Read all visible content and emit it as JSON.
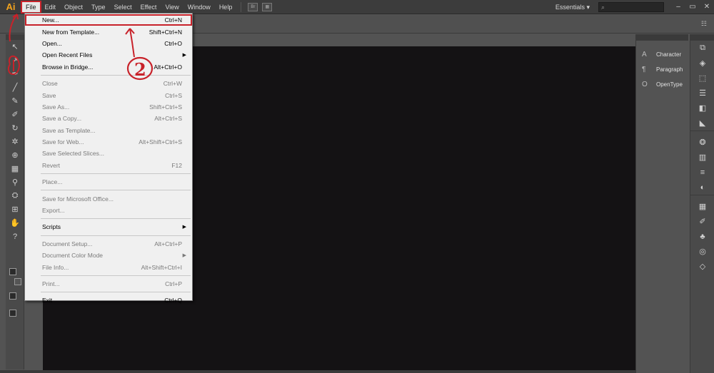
{
  "app": {
    "logo": "Ai"
  },
  "menubar": {
    "items": [
      "File",
      "Edit",
      "Object",
      "Type",
      "Select",
      "Effect",
      "View",
      "Window",
      "Help"
    ],
    "bridge_btn": "Br",
    "workspace": "Essentials",
    "workspace_arrow": "▾",
    "search_icon": "⌕",
    "window_controls": [
      "–",
      "▭",
      "✕"
    ]
  },
  "file_menu": {
    "groups": [
      [
        {
          "label": "New...",
          "shortcut": "Ctrl+N",
          "enabled": true,
          "highlighted": true
        },
        {
          "label": "New from Template...",
          "shortcut": "Shift+Ctrl+N",
          "enabled": true
        },
        {
          "label": "Open...",
          "shortcut": "Ctrl+O",
          "enabled": true
        },
        {
          "label": "Open Recent Files",
          "shortcut": "",
          "enabled": true,
          "submenu": true
        },
        {
          "label": "Browse in Bridge...",
          "shortcut": "Alt+Ctrl+O",
          "enabled": true
        }
      ],
      [
        {
          "label": "Close",
          "shortcut": "Ctrl+W",
          "enabled": false
        },
        {
          "label": "Save",
          "shortcut": "Ctrl+S",
          "enabled": false
        },
        {
          "label": "Save As...",
          "shortcut": "Shift+Ctrl+S",
          "enabled": false
        },
        {
          "label": "Save a Copy...",
          "shortcut": "Alt+Ctrl+S",
          "enabled": false
        },
        {
          "label": "Save as Template...",
          "shortcut": "",
          "enabled": false
        },
        {
          "label": "Save for Web...",
          "shortcut": "Alt+Shift+Ctrl+S",
          "enabled": false
        },
        {
          "label": "Save Selected Slices...",
          "shortcut": "",
          "enabled": false
        },
        {
          "label": "Revert",
          "shortcut": "F12",
          "enabled": false
        }
      ],
      [
        {
          "label": "Place...",
          "shortcut": "",
          "enabled": false
        }
      ],
      [
        {
          "label": "Save for Microsoft Office...",
          "shortcut": "",
          "enabled": false
        },
        {
          "label": "Export...",
          "shortcut": "",
          "enabled": false
        }
      ],
      [
        {
          "label": "Scripts",
          "shortcut": "",
          "enabled": true,
          "submenu": true
        }
      ],
      [
        {
          "label": "Document Setup...",
          "shortcut": "Alt+Ctrl+P",
          "enabled": false
        },
        {
          "label": "Document Color Mode",
          "shortcut": "",
          "enabled": false,
          "submenu": true
        },
        {
          "label": "File Info...",
          "shortcut": "Alt+Shift+Ctrl+I",
          "enabled": false
        }
      ],
      [
        {
          "label": "Print...",
          "shortcut": "Ctrl+P",
          "enabled": false
        }
      ],
      [
        {
          "label": "Exit",
          "shortcut": "Ctrl+Q",
          "enabled": true
        }
      ]
    ]
  },
  "tools": [
    {
      "name": "selection-tool-icon",
      "glyph": "↖"
    },
    {
      "name": "direct-selection-tool-icon",
      "glyph": "↗"
    },
    {
      "name": "pen-tool-icon",
      "glyph": "✒"
    },
    {
      "name": "line-tool-icon",
      "glyph": "╱"
    },
    {
      "name": "brush-tool-icon",
      "glyph": "✎"
    },
    {
      "name": "blob-brush-tool-icon",
      "glyph": "✐"
    },
    {
      "name": "rotate-tool-icon",
      "glyph": "↻"
    },
    {
      "name": "puppet-warp-tool-icon",
      "glyph": "✲"
    },
    {
      "name": "shape-builder-tool-icon",
      "glyph": "⊕"
    },
    {
      "name": "perspective-grid-tool-icon",
      "glyph": "▦"
    },
    {
      "name": "eyedropper-tool-icon",
      "glyph": "⚲"
    },
    {
      "name": "symbol-sprayer-tool-icon",
      "glyph": "⛭"
    },
    {
      "name": "artboard-tool-icon",
      "glyph": "⊞"
    },
    {
      "name": "hand-tool-icon",
      "glyph": "✋"
    },
    {
      "name": "help-icon",
      "glyph": "?"
    }
  ],
  "panels": [
    {
      "label": "Character",
      "icon": "A"
    },
    {
      "label": "Paragraph",
      "icon": "¶"
    },
    {
      "label": "OpenType",
      "icon": "O"
    }
  ],
  "strip_icons": [
    {
      "name": "artboards-panel-icon",
      "glyph": "⧉"
    },
    {
      "name": "layers-panel-icon",
      "glyph": "◈"
    },
    {
      "name": "transform-panel-icon",
      "glyph": "⬚"
    },
    {
      "name": "align-panel-icon",
      "glyph": "☰"
    },
    {
      "name": "pathfinder-panel-icon",
      "glyph": "◧"
    },
    {
      "name": "gradient-mesh-icon",
      "glyph": "◣"
    },
    {
      "name": "color-panel-icon",
      "glyph": "❂"
    },
    {
      "name": "gradient-panel-icon",
      "glyph": "▥"
    },
    {
      "name": "stroke-panel-icon",
      "glyph": "≡"
    },
    {
      "name": "transparency-panel-icon",
      "glyph": "◐"
    },
    {
      "name": "swatches-panel-icon",
      "glyph": "▦"
    },
    {
      "name": "brushes-panel-icon",
      "glyph": "✐"
    },
    {
      "name": "symbols-panel-icon",
      "glyph": "♣"
    },
    {
      "name": "graphic-styles-panel-icon",
      "glyph": "◎"
    },
    {
      "name": "appearance-panel-icon",
      "glyph": "◇"
    }
  ],
  "annotation": {
    "step_label": "2",
    "color": "#c8222a"
  }
}
